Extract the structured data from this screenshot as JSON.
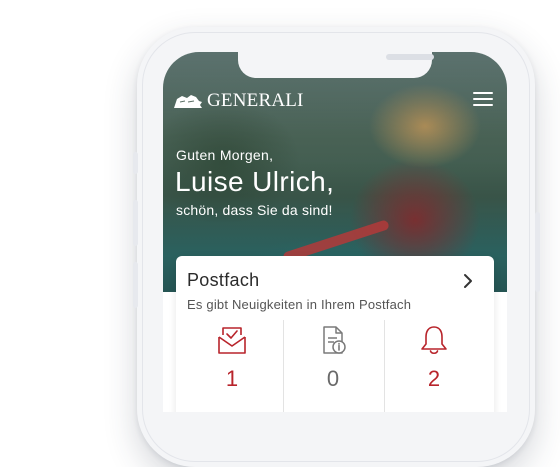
{
  "header": {
    "logo_text": "GENERALI",
    "menu_icon": "hamburger-menu-icon"
  },
  "greeting": {
    "salutation": "Guten Morgen,",
    "name": "Luise Ulrich,",
    "subline": "schön, dass Sie da sind!"
  },
  "mailbox_card": {
    "title": "Postfach",
    "subtitle": "Es gibt Neuigkeiten in Ihrem Postfach",
    "stats": [
      {
        "icon": "envelope-check-icon",
        "count": "1"
      },
      {
        "icon": "document-info-icon",
        "count": "0"
      },
      {
        "icon": "bell-icon",
        "count": "2"
      }
    ]
  },
  "colors": {
    "brand_red": "#b8242b",
    "neutral_gray": "#6a6a6a",
    "phone_frame": "#f4f5f7"
  }
}
